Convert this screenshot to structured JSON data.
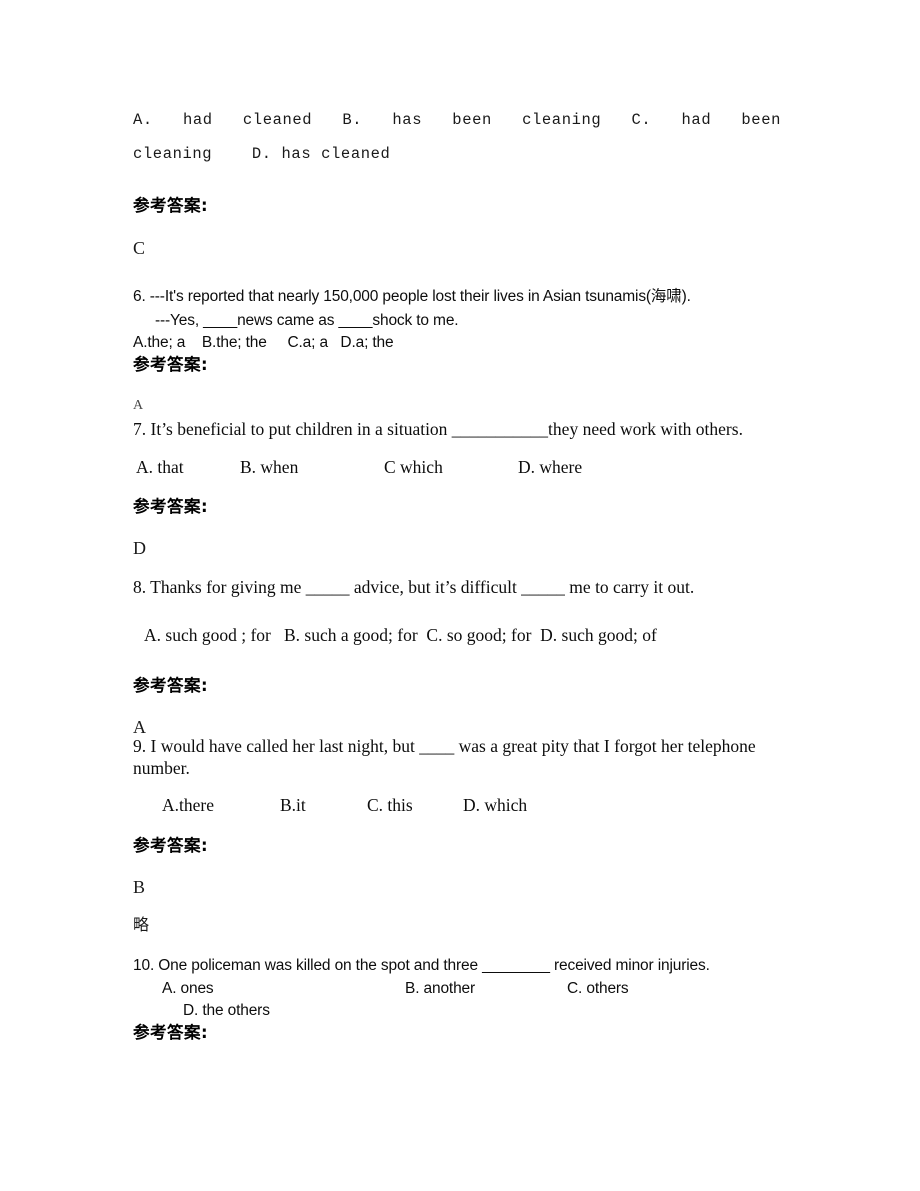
{
  "document": {
    "background_color": "#ffffff",
    "text_color": "#000000",
    "answer_label": "参考答案:",
    "omitted_marker": "略"
  },
  "q5_options": {
    "line1_a": "A. had cleaned",
    "line1_b": "B. has been cleaning",
    "line1_c": "C. had been",
    "line2": "cleaning    D. has cleaned",
    "answer_label": "参考答案:",
    "answer": "C"
  },
  "questions": [
    {
      "id": "q6",
      "style": "sans",
      "stem_line1": "6. ---It's reported that nearly 150,000 people lost their lives in Asian tsunamis(海啸).",
      "stem_line2": "---Yes, ____news came as ____shock to me.",
      "options_line": "A.the; a    B.the; the     C.a; a   D.a; the",
      "answer_label": "参考答案:",
      "answer": "A"
    },
    {
      "id": "q7",
      "style": "serif",
      "stem_line1": "7. It’s beneficial to put children in a situation ___________they need work with others.",
      "options": [
        "A. that",
        "B. when",
        "C which",
        "D. where"
      ],
      "answer_label": "参考答案:",
      "answer": "D"
    },
    {
      "id": "q8",
      "style": "serif",
      "stem_line1": "8. Thanks for giving me _____ advice, but it’s difficult _____ me to carry it out.",
      "options_line": "A. such good ; for   B. such a good; for  C. so good; for  D. such good; of",
      "answer_label": "参考答案:",
      "answer": "A"
    },
    {
      "id": "q9",
      "style": "serif",
      "stem_line1": "9. I would have called her last night, but ____ was a great pity that I forgot her telephone",
      "stem_line2": "number.",
      "options": [
        "A.there",
        "B.it",
        "C. this",
        "D. which"
      ],
      "answer_label": "参考答案:",
      "answer": "B",
      "omitted_marker": "略"
    },
    {
      "id": "q10",
      "style": "sans",
      "stem_line1": "10. One policeman was killed on the spot and three ________ received minor injuries.",
      "options_row1": [
        "A. ones",
        "B. another",
        "C. others"
      ],
      "options_row2": "D. the others",
      "answer_label": "参考答案:"
    }
  ]
}
